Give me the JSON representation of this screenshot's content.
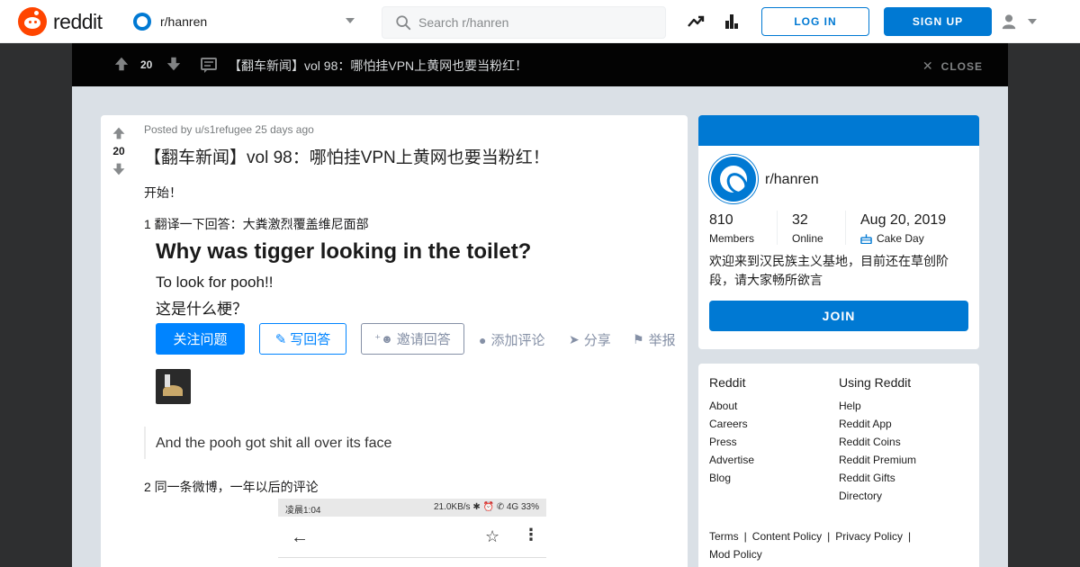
{
  "header": {
    "logo_text": "reddit",
    "community": "r/hanren",
    "search_placeholder": "Search r/hanren",
    "login_label": "LOG IN",
    "signup_label": "SIGN UP",
    "brand_color": "#ff4500",
    "accent_color": "#0079d3",
    "icons": [
      "trending-icon",
      "stats-icon",
      "user-icon"
    ]
  },
  "postbar": {
    "score": "20",
    "title": "【翻车新闻】vol 98：哪怕挂VPN上黄网也要当粉红！",
    "close_label": "CLOSE"
  },
  "post": {
    "score": "20",
    "meta": "Posted by u/s1refugee 25 days ago",
    "title": "【翻车新闻】vol 98：哪怕挂VPN上黄网也要当粉红！",
    "intro": "开始！",
    "item1": "1 翻译一下回答：大粪激烈覆盖维尼面部",
    "item2": "2 同一条微博，一年以后的评论",
    "embed": {
      "question": "Why was tigger looking in the toilet?",
      "answer_line1": "To look for pooh!!",
      "answer_line2": "这是什么梗？",
      "follow_btn": "关注问题",
      "write_btn": "写回答",
      "invite_btn": "邀请回答",
      "comment_link": "添加评论",
      "share_link": "分享",
      "report_link": "举报",
      "caption": "And the pooh got shit all over its face"
    },
    "phone": {
      "time": "凌晨1:04",
      "status": "21.0KB/s ✱ ⏰ ✆ 4G 33%"
    }
  },
  "sidebar": {
    "community_name": "r/hanren",
    "members_count": "810",
    "members_label": "Members",
    "online_count": "32",
    "online_label": "Online",
    "cake_date": "Aug 20, 2019",
    "cake_label": "Cake Day",
    "description": "欢迎来到汉民族主义基地，目前还在草创阶段，请大家畅所欲言",
    "join_label": "JOIN"
  },
  "footer": {
    "col1_title": "Reddit",
    "col1_links": [
      "About",
      "Careers",
      "Press",
      "Advertise",
      "Blog"
    ],
    "col2_title": "Using Reddit",
    "col2_links": [
      "Help",
      "Reddit App",
      "Reddit Coins",
      "Reddit Premium",
      "Reddit Gifts",
      "Directory"
    ],
    "terms": [
      "Terms",
      "Content Policy",
      "Privacy Policy",
      "Mod Policy"
    ]
  }
}
